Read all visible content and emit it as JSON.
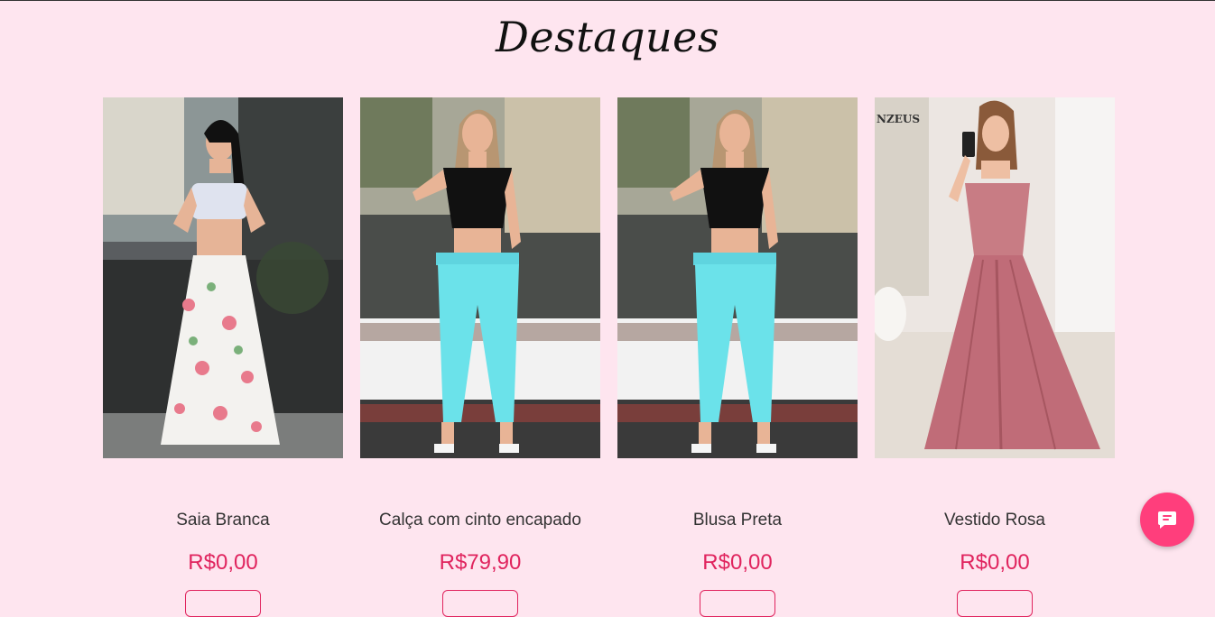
{
  "section": {
    "title": "Destaques"
  },
  "products": [
    {
      "name": "Saia Branca",
      "price": "R$0,00",
      "image_icon": "product-photo-white-floral-skirt"
    },
    {
      "name": "Calça com cinto encapado",
      "price": "R$79,90",
      "image_icon": "product-photo-turquoise-pants"
    },
    {
      "name": "Blusa Preta",
      "price": "R$0,00",
      "image_icon": "product-photo-black-blouse"
    },
    {
      "name": "Vestido Rosa",
      "price": "R$0,00",
      "image_icon": "product-photo-pink-dress"
    }
  ],
  "watermark": "NZEUS",
  "chat": {
    "icon": "chat-bubble-icon"
  },
  "colors": {
    "background": "#fee5ef",
    "price": "#e0245e",
    "chat": "#ff3e7c"
  }
}
